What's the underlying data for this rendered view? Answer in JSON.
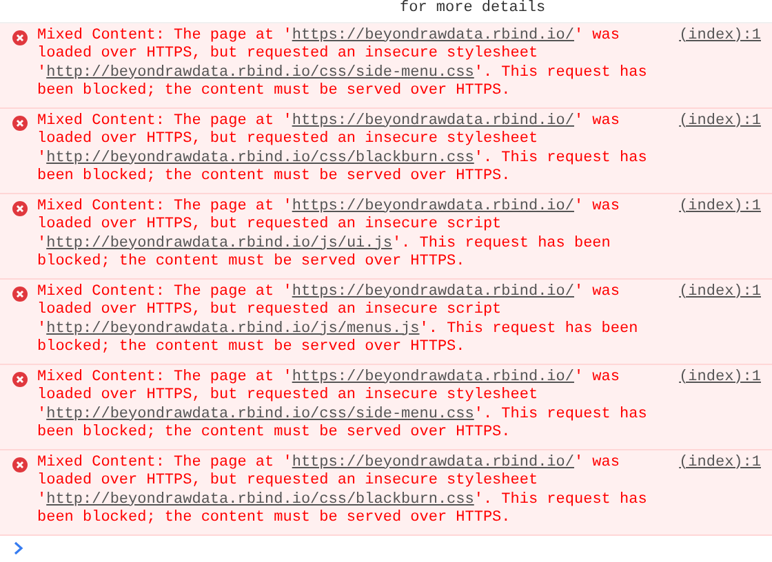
{
  "previous_line": {
    "text": "for more details"
  },
  "messages": [
    {
      "kind": "error",
      "source": "(index):1",
      "segments": [
        {
          "kind": "text",
          "text": "Mixed Content: The page at '"
        },
        {
          "kind": "link",
          "text": "https://beyondrawdata.rbind.io/"
        },
        {
          "kind": "text",
          "text": "' was loaded over HTTPS, but requested an insecure stylesheet '"
        },
        {
          "kind": "link",
          "text": "http://beyondrawdata.rbind.io/css/side-menu.css"
        },
        {
          "kind": "text",
          "text": "'. This request has been blocked; the content must be served over HTTPS."
        }
      ]
    },
    {
      "kind": "error",
      "source": "(index):1",
      "segments": [
        {
          "kind": "text",
          "text": "Mixed Content: The page at '"
        },
        {
          "kind": "link",
          "text": "https://beyondrawdata.rbind.io/"
        },
        {
          "kind": "text",
          "text": "' was loaded over HTTPS, but requested an insecure stylesheet '"
        },
        {
          "kind": "link",
          "text": "http://beyondrawdata.rbind.io/css/blackburn.css"
        },
        {
          "kind": "text",
          "text": "'. This request has been blocked; the content must be served over HTTPS."
        }
      ]
    },
    {
      "kind": "error",
      "source": "(index):1",
      "segments": [
        {
          "kind": "text",
          "text": "Mixed Content: The page at '"
        },
        {
          "kind": "link",
          "text": "https://beyondrawdata.rbind.io/"
        },
        {
          "kind": "text",
          "text": "' was loaded over HTTPS, but requested an insecure script '"
        },
        {
          "kind": "link",
          "text": "http://beyondrawdata.rbind.io/js/ui.js"
        },
        {
          "kind": "text",
          "text": "'. This request has been blocked; the content must be served over HTTPS."
        }
      ]
    },
    {
      "kind": "error",
      "source": "(index):1",
      "segments": [
        {
          "kind": "text",
          "text": "Mixed Content: The page at '"
        },
        {
          "kind": "link",
          "text": "https://beyondrawdata.rbind.io/"
        },
        {
          "kind": "text",
          "text": "' was loaded over HTTPS, but requested an insecure script '"
        },
        {
          "kind": "link",
          "text": "http://beyondrawdata.rbind.io/js/menus.js"
        },
        {
          "kind": "text",
          "text": "'. This request has been blocked; the content must be served over HTTPS."
        }
      ]
    },
    {
      "kind": "error",
      "source": "(index):1",
      "segments": [
        {
          "kind": "text",
          "text": "Mixed Content: The page at '"
        },
        {
          "kind": "link",
          "text": "https://beyondrawdata.rbind.io/"
        },
        {
          "kind": "text",
          "text": "' was loaded over HTTPS, but requested an insecure stylesheet '"
        },
        {
          "kind": "link",
          "text": "http://beyondrawdata.rbind.io/css/side-menu.css"
        },
        {
          "kind": "text",
          "text": "'. This request has been blocked; the content must be served over HTTPS."
        }
      ]
    },
    {
      "kind": "error",
      "source": "(index):1",
      "segments": [
        {
          "kind": "text",
          "text": "Mixed Content: The page at '"
        },
        {
          "kind": "link",
          "text": "https://beyondrawdata.rbind.io/"
        },
        {
          "kind": "text",
          "text": "' was loaded over HTTPS, but requested an insecure stylesheet '"
        },
        {
          "kind": "link",
          "text": "http://beyondrawdata.rbind.io/css/blackburn.css"
        },
        {
          "kind": "text",
          "text": "'. This request has been blocked; the content must be served over HTTPS."
        }
      ]
    }
  ]
}
